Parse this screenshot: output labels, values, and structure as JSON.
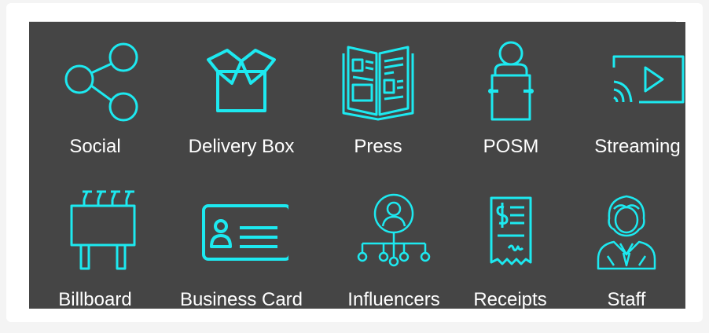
{
  "accent_color": "#1de9f0",
  "panel_color": "#454545",
  "rows": [
    [
      {
        "label": "Social",
        "icon": "share-icon"
      },
      {
        "label": "Delivery Box",
        "icon": "box-icon"
      },
      {
        "label": "Press",
        "icon": "newspaper-icon"
      },
      {
        "label": "POSM",
        "icon": "posm-icon"
      },
      {
        "label": "Streaming",
        "icon": "streaming-icon"
      }
    ],
    [
      {
        "label": "Billboard",
        "icon": "billboard-icon"
      },
      {
        "label": "Business Card",
        "icon": "business-card-icon"
      },
      {
        "label": "Influencers",
        "icon": "influencer-network-icon"
      },
      {
        "label": "Receipts",
        "icon": "receipt-icon"
      },
      {
        "label": "Staff",
        "icon": "staff-icon"
      }
    ]
  ]
}
